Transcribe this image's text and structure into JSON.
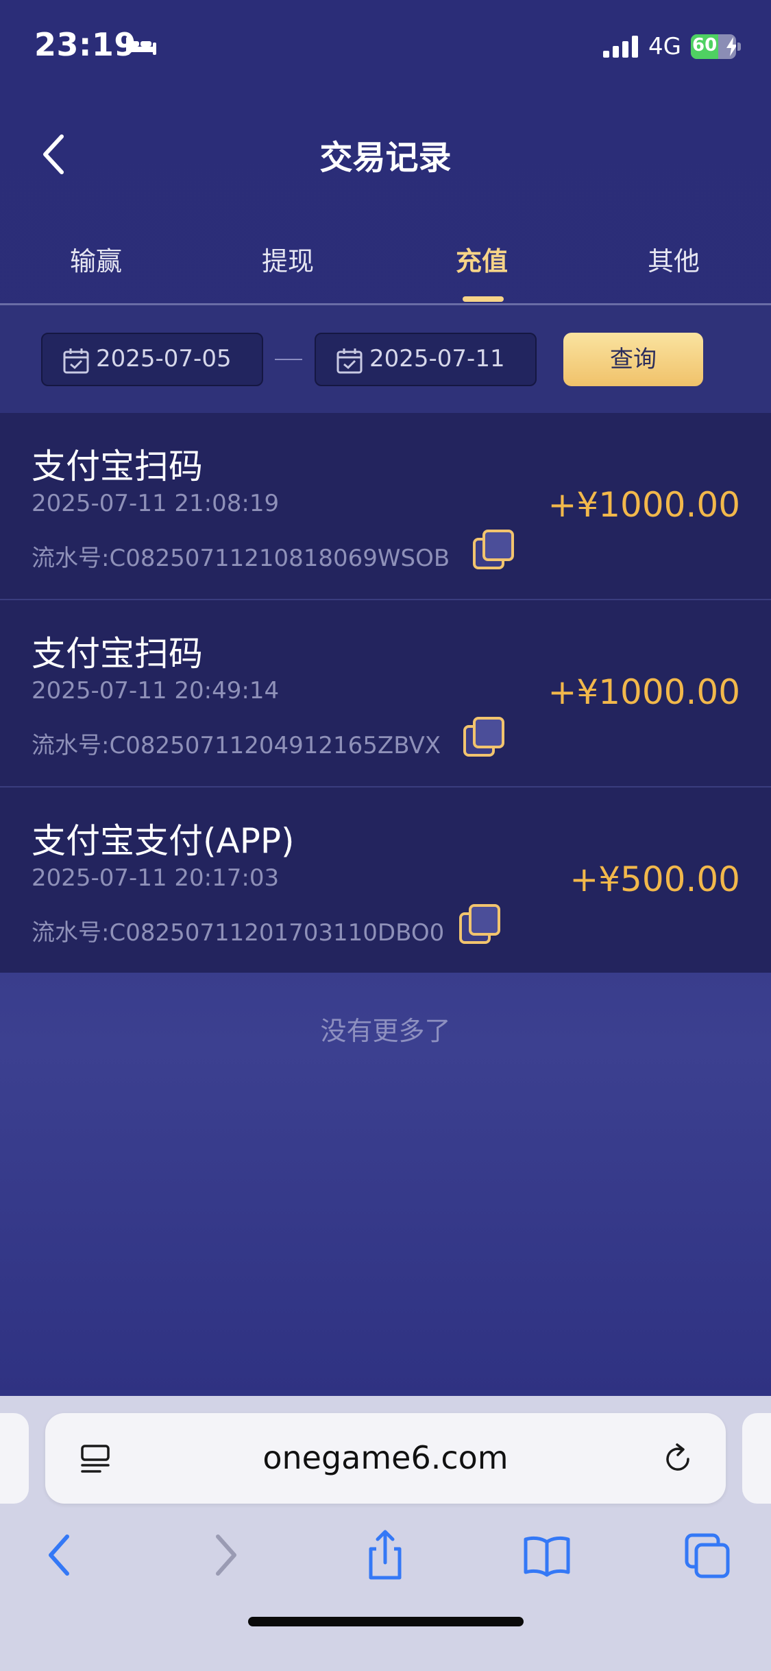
{
  "status_bar": {
    "time": "23:19",
    "network": "4G",
    "battery": "60",
    "battery_level": 0.6
  },
  "header": {
    "title": "交易记录",
    "back_icon": "chevron-left-icon"
  },
  "tabs": [
    {
      "label": "输赢",
      "active": false
    },
    {
      "label": "提现",
      "active": false
    },
    {
      "label": "充值",
      "active": true
    },
    {
      "label": "其他",
      "active": false
    }
  ],
  "filter": {
    "start_date": "2025-07-05",
    "end_date": "2025-07-11",
    "query_label": "查询"
  },
  "records": [
    {
      "title": "支付宝扫码",
      "time": "2025-07-11 21:08:19",
      "serial": "流水号:C0825071121081806​9WSOB",
      "amount": "+¥1000.00"
    },
    {
      "title": "支付宝扫码",
      "time": "2025-07-11 20:49:14",
      "serial": "流水号:C08250711204912165ZBVX",
      "amount": "+¥1000.00"
    },
    {
      "title": "支付宝支付(APP)",
      "time": "2025-07-11 20:17:03",
      "serial": "流水号:C0825071120170311​0DBO0",
      "amount": "+¥500.00"
    }
  ],
  "list_footer": "没有更多了",
  "browser": {
    "url": "onegame6.com"
  },
  "colors": {
    "background": "#2b2d78",
    "accent_gold": "#f7d488",
    "amount": "#f2b84b",
    "row_bg": "#23245e"
  }
}
